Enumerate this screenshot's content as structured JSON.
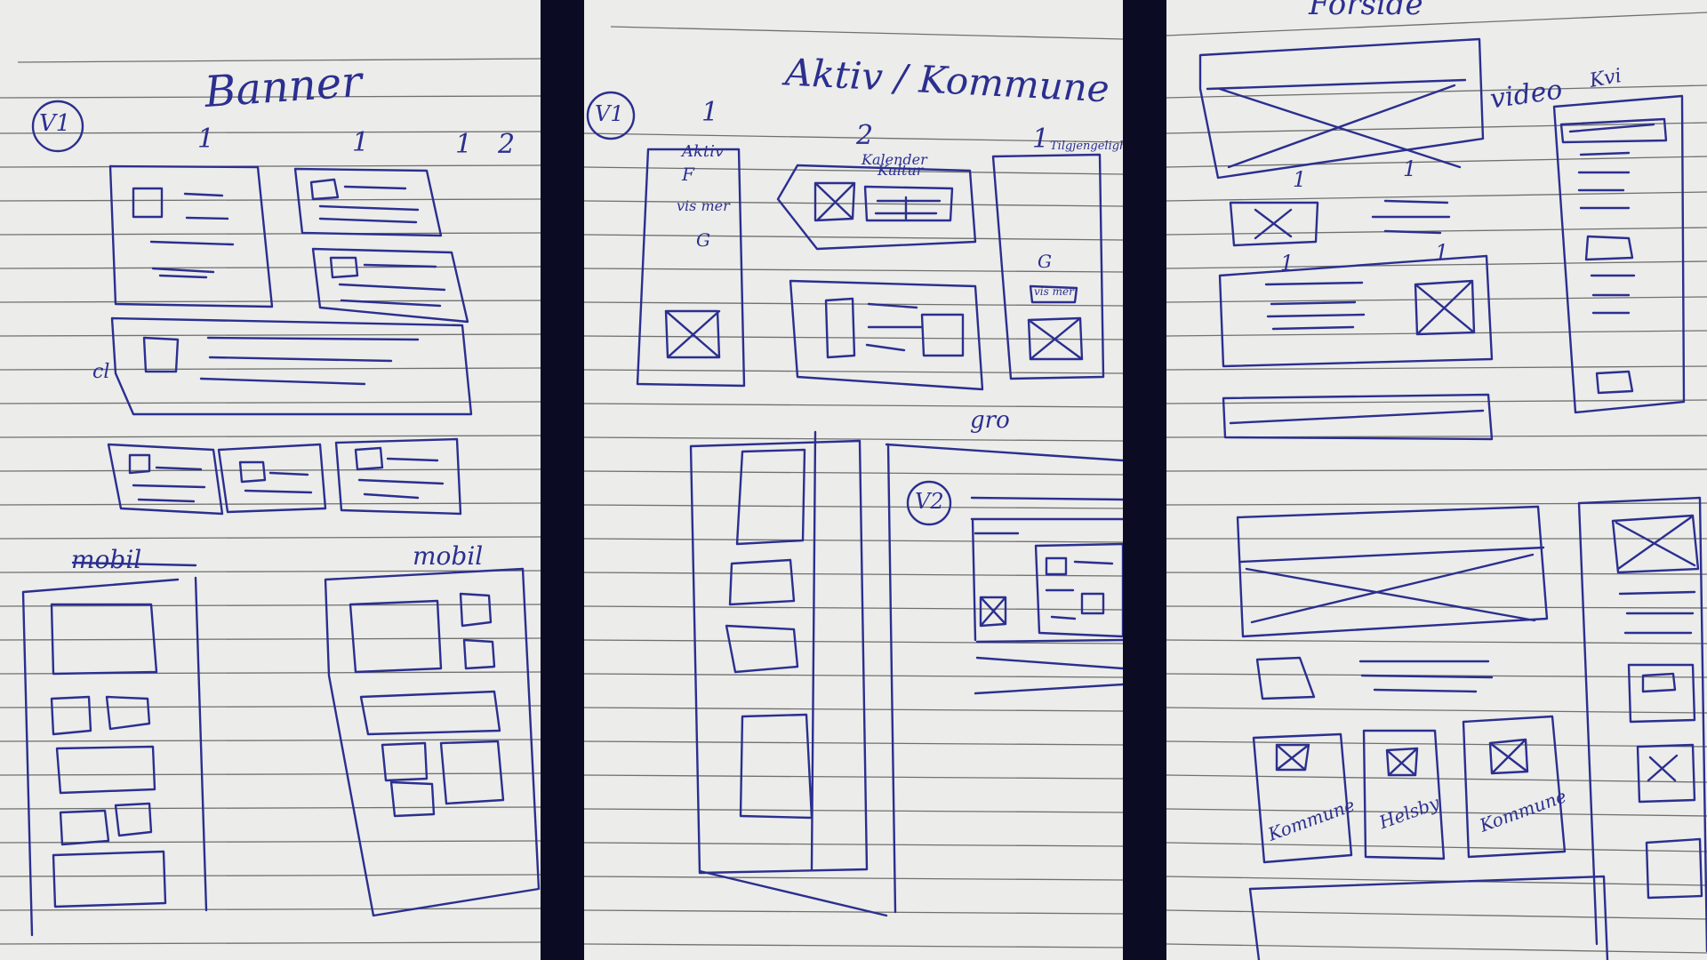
{
  "panels": [
    {
      "id": "left",
      "heading": "Banner",
      "badge": "V1",
      "col_numbers": [
        "1",
        "1",
        "1"
      ],
      "corner_note": "2",
      "side_note": "cl",
      "mobile_labels": [
        "mobil",
        "mobil"
      ]
    },
    {
      "id": "middle",
      "heading": "Aktiv / Kommune",
      "badge": "V1",
      "col_numbers": [
        "1",
        "2",
        "1"
      ],
      "notes": [
        "Aktiv",
        "Kalender",
        "F",
        "vis mer",
        "G",
        "G",
        "vis mer"
      ],
      "scribbles": [
        "Kultur",
        "Tilgjengelighet"
      ],
      "tag": "gro",
      "badge2": "V2"
    },
    {
      "id": "right",
      "heading_top": "Forside",
      "video_label": "video",
      "kvi_label": "Kvi",
      "col_numbers": [
        "1",
        "1",
        "1",
        "1"
      ],
      "card_captions": [
        "Kommune",
        "Helsby",
        "Kommune"
      ]
    }
  ],
  "colors": {
    "ink": "#2b2f8f",
    "paper": "#efefed",
    "rule": "#3a3a3a",
    "divider": "#0b0b24"
  }
}
